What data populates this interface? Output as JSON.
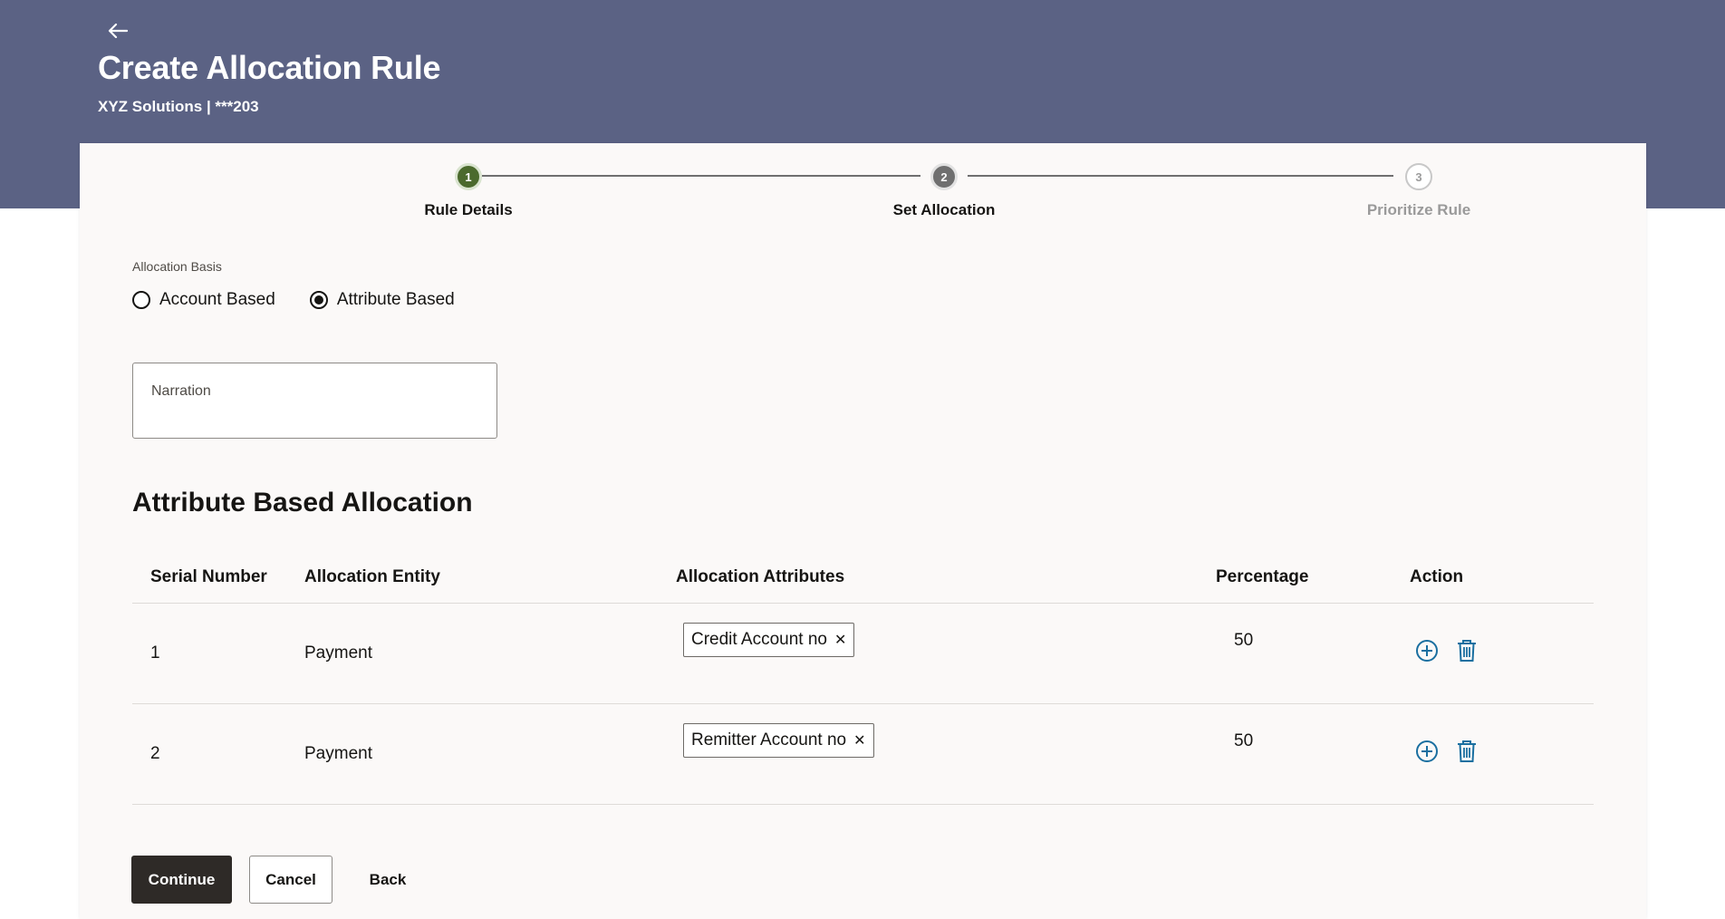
{
  "header": {
    "back_icon": "back-arrow-icon",
    "title": "Create Allocation Rule",
    "subtitle": "XYZ Solutions | ***203"
  },
  "stepper": {
    "steps": [
      {
        "number": "1",
        "label": "Rule Details",
        "state": "completed"
      },
      {
        "number": "2",
        "label": "Set Allocation",
        "state": "current"
      },
      {
        "number": "3",
        "label": "Prioritize Rule",
        "state": "pending"
      }
    ]
  },
  "form": {
    "allocation_basis_label": "Allocation Basis",
    "options": [
      {
        "label": "Account Based",
        "selected": false
      },
      {
        "label": "Attribute Based",
        "selected": true
      }
    ],
    "narration_label": "Narration",
    "narration_value": ""
  },
  "section": {
    "title": "Attribute Based Allocation"
  },
  "table": {
    "columns": [
      "Serial Number",
      "Allocation Entity",
      "Allocation Attributes",
      "Percentage",
      "Action"
    ],
    "rows": [
      {
        "serial": "1",
        "entity": "Payment",
        "attribute": "Credit Account no",
        "percentage": "50"
      },
      {
        "serial": "2",
        "entity": "Payment",
        "attribute": "Remitter Account no",
        "percentage": "50"
      }
    ],
    "action_icons": [
      "add-circle-icon",
      "trash-icon"
    ],
    "chip_remove_icon": "close-icon"
  },
  "buttons": {
    "continue": "Continue",
    "cancel": "Cancel",
    "back": "Back"
  },
  "colors": {
    "banner": "#5b6284",
    "step_done": "#4b6a2d",
    "primary_button": "#2e2a27",
    "action_icon": "#1a6fa0"
  }
}
